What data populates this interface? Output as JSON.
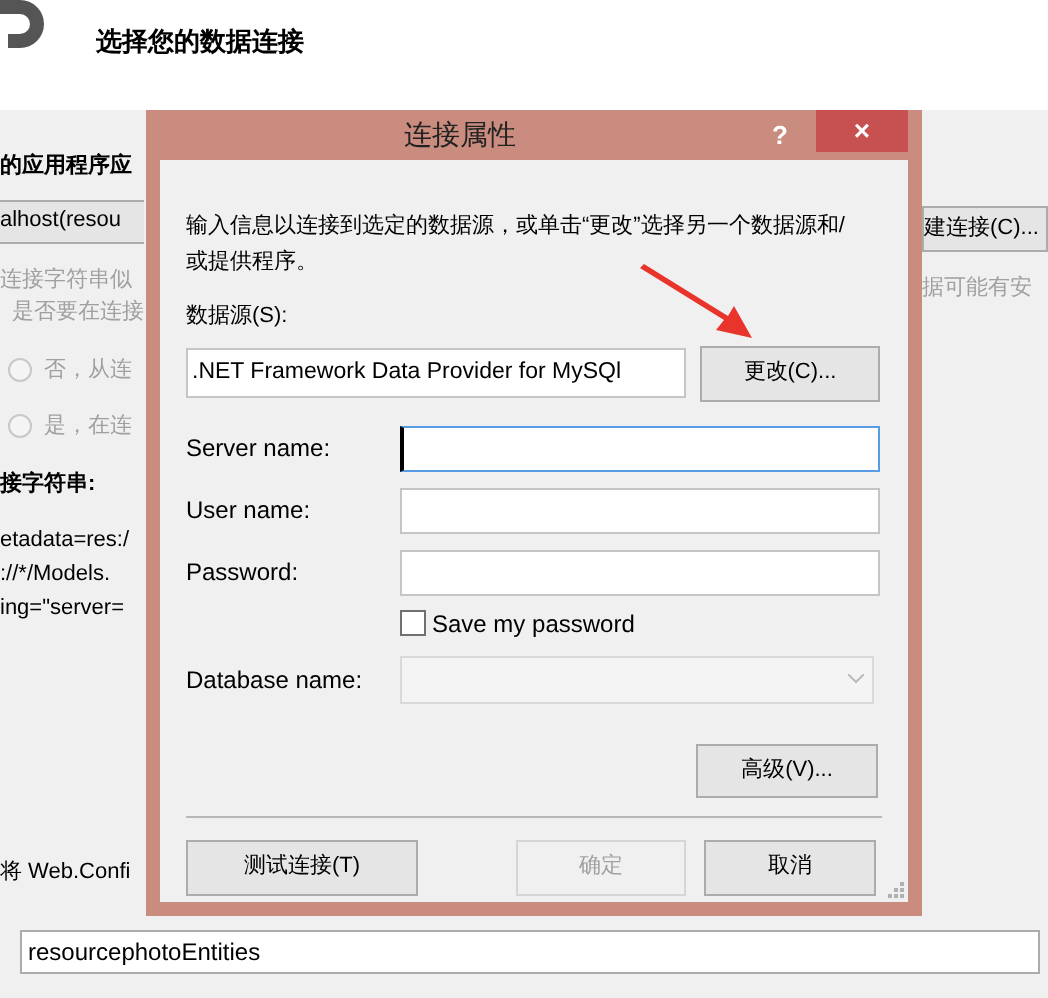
{
  "wizard": {
    "title": "选择您的数据连接",
    "section_heading": "的应用程序应",
    "connection_dropdown": "alhost(resou",
    "new_connection_button": "建连接(C)...",
    "warning_line_1": "连接字符串似",
    "warning_line_2": "是否要在连接",
    "warning_line_right": "据可能有安",
    "radios": [
      {
        "label": "否，从连",
        "selected": false
      },
      {
        "label": "是，在连",
        "selected": false
      }
    ],
    "connection_string_label": "接字符串:",
    "connection_string_lines": [
      "etadata=res:/",
      "://*/Models.",
      "ing=\"server="
    ],
    "save_label": "将 Web.Confi",
    "entities_name": "resourcephotoEntities"
  },
  "dialog": {
    "title": "连接属性",
    "help": "?",
    "close": "×",
    "description": "输入信息以连接到选定的数据源，或单击“更改”选择另一个数据源和/或提供程序。",
    "data_source_label": "数据源(S):",
    "data_source_value": ".NET Framework Data Provider for MySQl",
    "change_button": "更改(C)...",
    "fields": [
      {
        "label": "Server name:",
        "focused": true
      },
      {
        "label": "User name:",
        "focused": false
      },
      {
        "label": "Password:",
        "focused": false
      }
    ],
    "save_password": {
      "label": "Save my password",
      "checked": false
    },
    "database_label": "Database name:",
    "database_disabled": true,
    "advanced_button": "高级(V)...",
    "buttons": [
      {
        "label": "测试连接(T)",
        "disabled": false
      },
      {
        "label": "确定",
        "disabled": true
      },
      {
        "label": "取消",
        "disabled": false
      }
    ]
  }
}
